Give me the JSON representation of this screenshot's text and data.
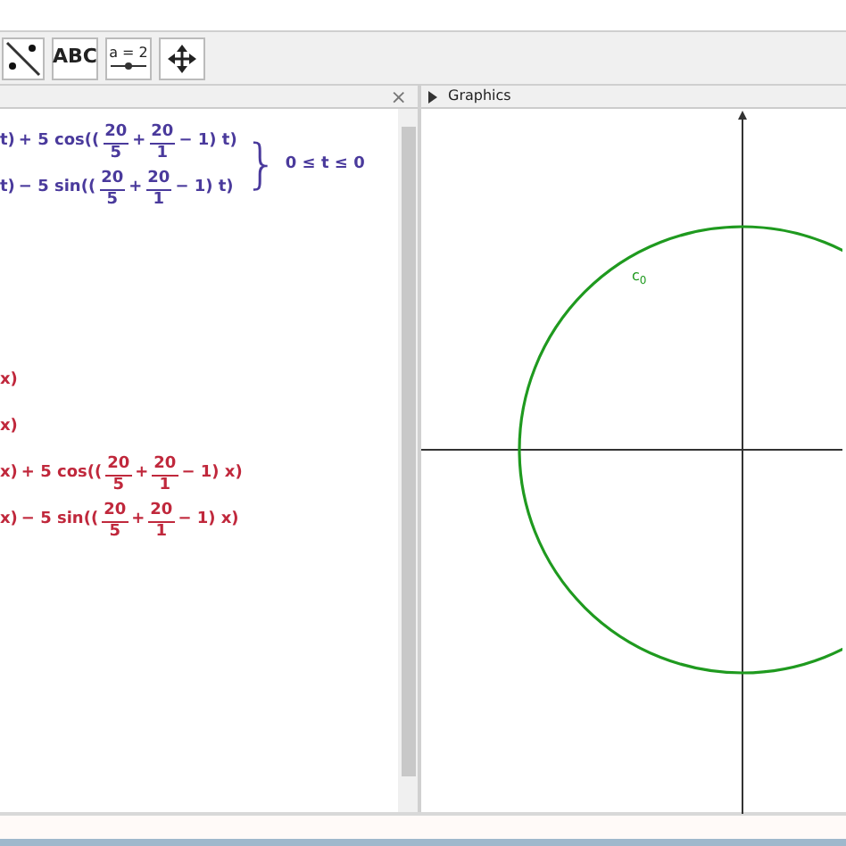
{
  "toolbar": [
    {
      "kind": "line-tool"
    },
    {
      "kind": "text-tool",
      "label": "ABC"
    },
    {
      "kind": "slider-tool",
      "label": "a = 2"
    },
    {
      "kind": "move-tool"
    }
  ],
  "algebra_view": {
    "close": "×",
    "curve": {
      "color": "#4a3a9c",
      "lines": [
        [
          {
            "kind": "text",
            "text": "t)"
          },
          {
            "kind": "text",
            "text": "+ 5 cos(("
          },
          {
            "kind": "frac",
            "num": "20",
            "den": "5"
          },
          {
            "kind": "text",
            "text": "+"
          },
          {
            "kind": "frac",
            "num": "20",
            "den": "1"
          },
          {
            "kind": "text",
            "text": "− 1) t)"
          }
        ],
        [
          {
            "kind": "text",
            "text": "t)"
          },
          {
            "kind": "text",
            "text": "− 5 sin(("
          },
          {
            "kind": "frac",
            "num": "20",
            "den": "5"
          },
          {
            "kind": "text",
            "text": "+"
          },
          {
            "kind": "frac",
            "num": "20",
            "den": "1"
          },
          {
            "kind": "text",
            "text": "− 1) t)"
          }
        ]
      ],
      "brace": "}",
      "condition": "0 ≤ t ≤ 0"
    },
    "functions": {
      "color": "#c0283c",
      "lines": [
        [
          {
            "kind": "text",
            "text": "x)"
          }
        ],
        [
          {
            "kind": "text",
            "text": "x)"
          }
        ],
        [
          {
            "kind": "text",
            "text": "x)"
          },
          {
            "kind": "text",
            "text": "+ 5 cos(("
          },
          {
            "kind": "frac",
            "num": "20",
            "den": "5"
          },
          {
            "kind": "text",
            "text": "+"
          },
          {
            "kind": "frac",
            "num": "20",
            "den": "1"
          },
          {
            "kind": "text",
            "text": "− 1) x)"
          }
        ],
        [
          {
            "kind": "text",
            "text": "x)"
          },
          {
            "kind": "text",
            "text": "− 5 sin(("
          },
          {
            "kind": "frac",
            "num": "20",
            "den": "5"
          },
          {
            "kind": "text",
            "text": "+"
          },
          {
            "kind": "frac",
            "num": "20",
            "den": "1"
          },
          {
            "kind": "text",
            "text": "− 1) x)"
          }
        ]
      ]
    }
  },
  "graphics_view": {
    "title": "Graphics",
    "curve": {
      "label": "c",
      "label_sub": "0",
      "color": "#1f9a1f"
    }
  }
}
